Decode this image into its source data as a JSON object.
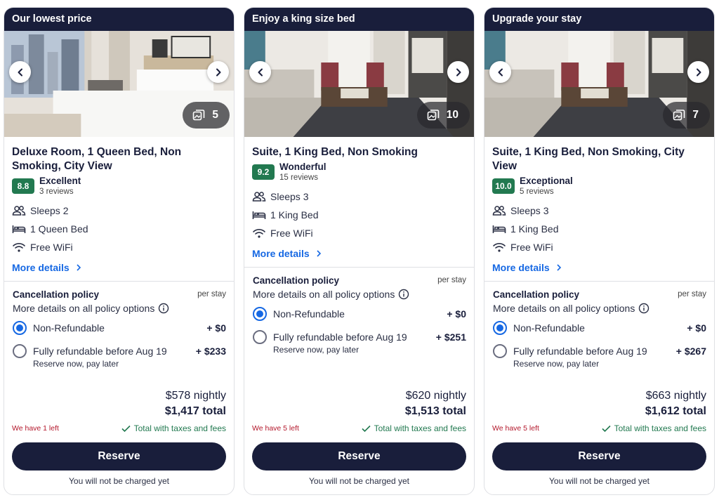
{
  "cards": [
    {
      "banner": "Our lowest price",
      "photo_count": "5",
      "title": "Deluxe Room, 1 Queen Bed, Non Smoking, City View",
      "score": "8.8",
      "rating_word": "Excellent",
      "review_count": "3 reviews",
      "amenities": [
        "Sleeps 2",
        "1 Queen Bed",
        "Free WiFi"
      ],
      "more_details": "More details",
      "policy_title": "Cancellation policy",
      "per_stay": "per stay",
      "policy_link": "More details on all policy options",
      "options": [
        {
          "label": "Non-Refundable",
          "price": "+ $0",
          "sub": "",
          "selected": true
        },
        {
          "label": "Fully refundable before Aug 19",
          "price": "+ $233",
          "sub": "Reserve now, pay later",
          "selected": false
        }
      ],
      "nightly": "$578 nightly",
      "total": "$1,417 total",
      "left": "We have 1 left",
      "taxes": "Total with taxes and fees",
      "reserve": "Reserve",
      "not_charged": "You will not be charged yet"
    },
    {
      "banner": "Enjoy a king size bed",
      "photo_count": "10",
      "title": "Suite, 1 King Bed, Non Smoking",
      "score": "9.2",
      "rating_word": "Wonderful",
      "review_count": "15 reviews",
      "amenities": [
        "Sleeps 3",
        "1 King Bed",
        "Free WiFi"
      ],
      "more_details": "More details",
      "policy_title": "Cancellation policy",
      "per_stay": "per stay",
      "policy_link": "More details on all policy options",
      "options": [
        {
          "label": "Non-Refundable",
          "price": "+ $0",
          "sub": "",
          "selected": true
        },
        {
          "label": "Fully refundable before Aug 19",
          "price": "+ $251",
          "sub": "Reserve now, pay later",
          "selected": false
        }
      ],
      "nightly": "$620 nightly",
      "total": "$1,513 total",
      "left": "We have 5 left",
      "taxes": "Total with taxes and fees",
      "reserve": "Reserve",
      "not_charged": "You will not be charged yet"
    },
    {
      "banner": "Upgrade your stay",
      "photo_count": "7",
      "title": "Suite, 1 King Bed, Non Smoking, City View",
      "score": "10.0",
      "rating_word": "Exceptional",
      "review_count": "5 reviews",
      "amenities": [
        "Sleeps 3",
        "1 King Bed",
        "Free WiFi"
      ],
      "more_details": "More details",
      "policy_title": "Cancellation policy",
      "per_stay": "per stay",
      "policy_link": "More details on all policy options",
      "options": [
        {
          "label": "Non-Refundable",
          "price": "+ $0",
          "sub": "",
          "selected": true
        },
        {
          "label": "Fully refundable before Aug 19",
          "price": "+ $267",
          "sub": "Reserve now, pay later",
          "selected": false
        }
      ],
      "nightly": "$663 nightly",
      "total": "$1,612 total",
      "left": "We have 5 left",
      "taxes": "Total with taxes and fees",
      "reserve": "Reserve",
      "not_charged": "You will not be charged yet"
    }
  ],
  "icons": {
    "prev": "chevron-left-icon",
    "next": "chevron-right-icon",
    "gallery": "gallery-icon",
    "sleeps": "people-icon",
    "bed": "bed-icon",
    "wifi": "wifi-icon",
    "info": "info-icon",
    "check": "check-icon"
  },
  "colors": {
    "brand_dark": "#191e3b",
    "link_blue": "#1668e3",
    "rating_green": "#227950",
    "scarcity_red": "#b3172b"
  }
}
